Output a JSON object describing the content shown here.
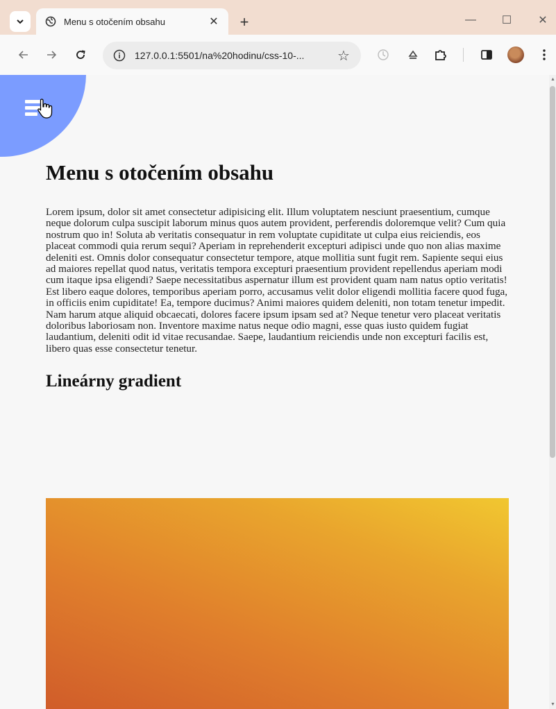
{
  "browser": {
    "tab_title": "Menu s otočením obsahu",
    "new_tab_label": "+",
    "url": "127.0.0.1:5501/na%20hodinu/css-10-...",
    "window_controls": {
      "minimize": "—",
      "maximize": "☐",
      "close": "✕"
    },
    "tab_close": "✕"
  },
  "icons": {
    "tab_search": "chevron-down-icon",
    "favicon": "globe-icon",
    "back": "back-arrow-icon",
    "forward": "forward-arrow-icon",
    "reload": "reload-icon",
    "site_info": "info-icon",
    "bookmark": "star-icon",
    "extension_1": "timer-icon",
    "extension_2": "eject-icon",
    "extensions": "puzzle-icon",
    "side_panel": "side-panel-icon",
    "profile": "avatar",
    "menu": "kebab-menu-icon",
    "hamburger": "hamburger-icon"
  },
  "page": {
    "heading": "Menu s otočením obsahu",
    "paragraph": "Lorem ipsum, dolor sit amet consectetur adipisicing elit. Illum voluptatem nesciunt praesentium, cumque neque dolorum culpa suscipit laborum minus quos autem provident, perferendis doloremque velit? Cum quia nostrum quo in! Soluta ab veritatis consequatur in rem voluptate cupiditate ut culpa eius reiciendis, eos placeat commodi quia rerum sequi? Aperiam in reprehenderit excepturi adipisci unde quo non alias maxime deleniti est. Omnis dolor consequatur consectetur tempore, atque mollitia sunt fugit rem. Sapiente sequi eius ad maiores repellat quod natus, veritatis tempora excepturi praesentium provident repellendus aperiam modi cum itaque ipsa eligendi? Saepe necessitatibus aspernatur illum est provident quam nam natus optio veritatis! Est libero eaque dolores, temporibus aperiam porro, accusamus velit dolor eligendi mollitia facere quod fuga, in officiis enim cupiditate! Ea, tempore ducimus? Animi maiores quidem deleniti, non totam tenetur impedit. Nam harum atque aliquid obcaecati, dolores facere ipsum ipsam sed at? Neque tenetur vero placeat veritatis doloribus laboriosam non. Inventore maxime natus neque odio magni, esse quas iusto quidem fugiat laudantium, deleniti odit id vitae recusandae. Saepe, laudantium reiciendis unde non excepturi facilis est, libero quas esse consectetur tenetur.",
    "subheading": "Lineárny gradient"
  },
  "colors": {
    "tabbar": "#f2ddd0",
    "menu_blob": "#7b9cff",
    "gradient_start": "#cf5a2a",
    "gradient_end": "#f1c730"
  }
}
